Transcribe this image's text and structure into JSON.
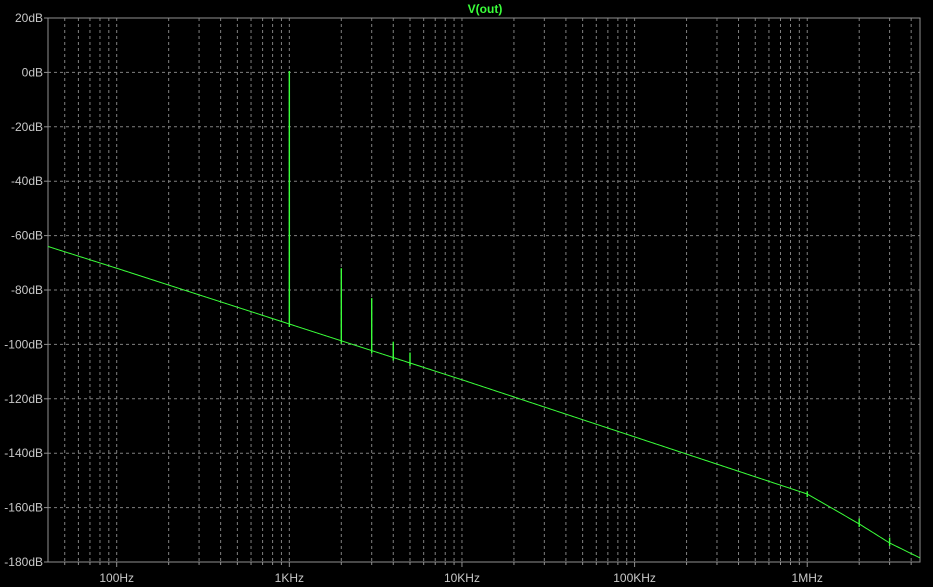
{
  "chart_data": {
    "type": "line",
    "title": "V(out)",
    "x_scale": "log",
    "xlim": [
      "40Hz",
      "4.5MHz"
    ],
    "ylim": [
      -180,
      20
    ],
    "x_tick_labels": [
      "100Hz",
      "1KHz",
      "10KHz",
      "100KHz",
      "1MHz"
    ],
    "y_tick_labels": [
      "20dB",
      "0dB",
      "-20dB",
      "-40dB",
      "-60dB",
      "-80dB",
      "-100dB",
      "-120dB",
      "-140dB",
      "-160dB",
      "-180dB"
    ],
    "grid": true,
    "series": [
      {
        "name": "V(out)",
        "color": "#3aff3a",
        "baseline": {
          "x_hz": [
            40,
            100,
            1000,
            10000,
            100000,
            1000000,
            2000000,
            3000000,
            4500000
          ],
          "y_db": [
            -64,
            -72,
            -92.5,
            -113,
            -134,
            -155,
            -166,
            -173,
            -178.5
          ]
        },
        "peaks": {
          "x_hz": [
            1000,
            2000,
            3000,
            4000,
            5000,
            1000000,
            2000000,
            3000000
          ],
          "y_db": [
            0.5,
            -72,
            -83,
            -99,
            -103,
            -154,
            -164,
            -171
          ]
        }
      }
    ]
  }
}
